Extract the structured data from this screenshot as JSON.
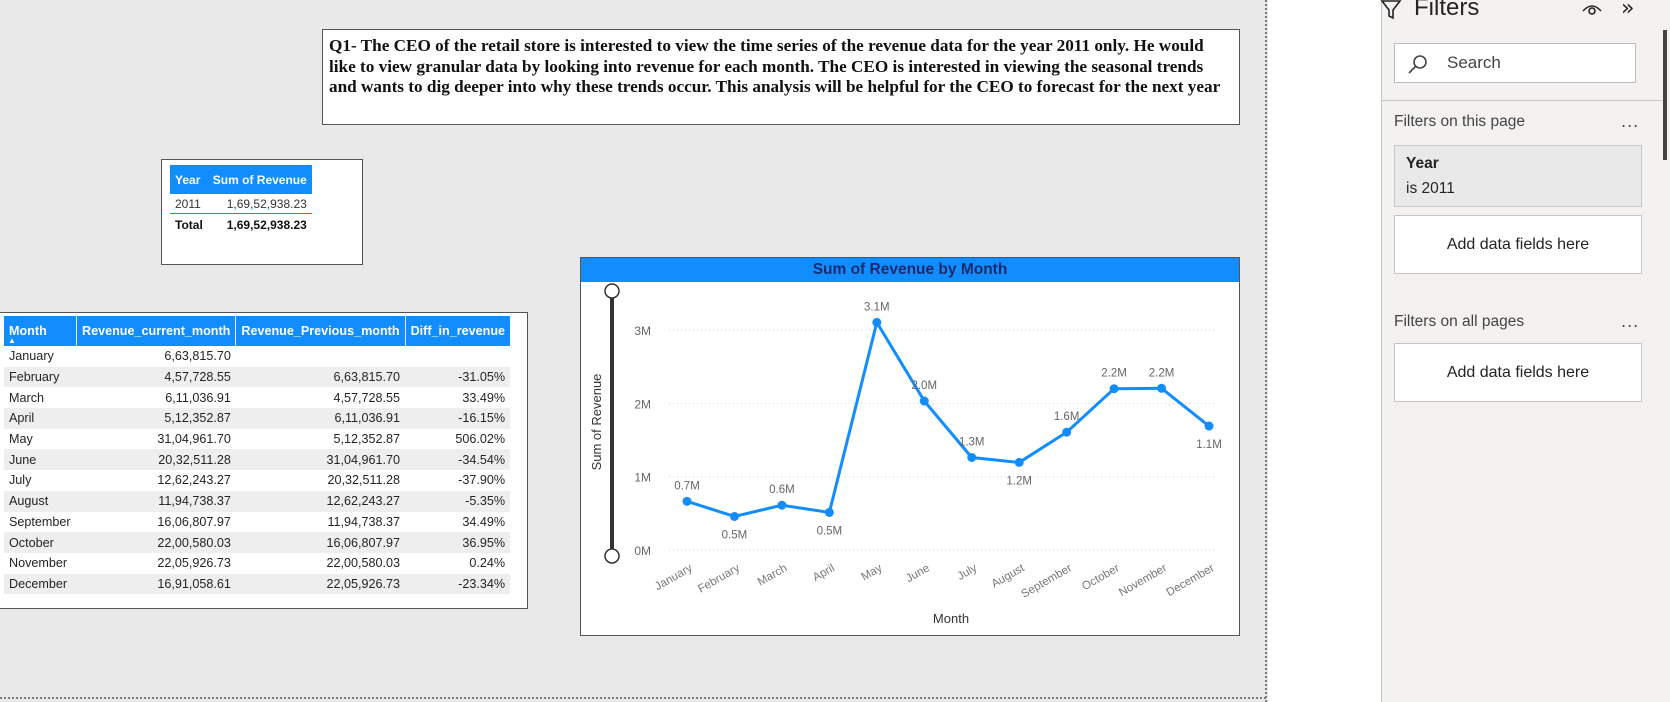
{
  "question": {
    "text": "Q1- The CEO of the retail store is interested to view the time series of the revenue data for the year 2011 only. He would like to view granular data by looking into revenue for each month. The CEO is interested in viewing the seasonal trends and wants to dig deeper into why these trends occur. This analysis will be helpful for the CEO to forecast for the next year"
  },
  "year_table": {
    "headers": [
      "Year",
      "Sum of Revenue"
    ],
    "rows": [
      [
        "2011",
        "1,69,52,938.23"
      ]
    ],
    "total": [
      "Total",
      "1,69,52,938.23"
    ]
  },
  "month_table": {
    "headers": [
      "Month",
      "Revenue_current_month",
      "Revenue_Previous_month",
      "Diff_in_revenue"
    ],
    "sort_indicator": "▲",
    "rows": [
      [
        "January",
        "6,63,815.70",
        "",
        ""
      ],
      [
        "February",
        "4,57,728.55",
        "6,63,815.70",
        "-31.05%"
      ],
      [
        "March",
        "6,11,036.91",
        "4,57,728.55",
        "33.49%"
      ],
      [
        "April",
        "5,12,352.87",
        "6,11,036.91",
        "-16.15%"
      ],
      [
        "May",
        "31,04,961.70",
        "5,12,352.87",
        "506.02%"
      ],
      [
        "June",
        "20,32,511.28",
        "31,04,961.70",
        "-34.54%"
      ],
      [
        "July",
        "12,62,243.27",
        "20,32,511.28",
        "-37.90%"
      ],
      [
        "August",
        "11,94,738.37",
        "12,62,243.27",
        "-5.35%"
      ],
      [
        "September",
        "16,06,807.97",
        "11,94,738.37",
        "34.49%"
      ],
      [
        "October",
        "22,00,580.03",
        "16,06,807.97",
        "36.95%"
      ],
      [
        "November",
        "22,05,926.73",
        "22,00,580.03",
        "0.24%"
      ],
      [
        "December",
        "16,91,058.61",
        "22,05,926.73",
        "-23.34%"
      ]
    ]
  },
  "chart_data": {
    "type": "line",
    "title": "Sum of Revenue by Month",
    "xlabel": "Month",
    "ylabel": "Sum of Revenue",
    "categories": [
      "January",
      "February",
      "March",
      "April",
      "May",
      "June",
      "July",
      "August",
      "September",
      "October",
      "November",
      "December"
    ],
    "series": [
      {
        "values": [
          663815.7,
          457728.55,
          611036.91,
          512352.87,
          3104961.7,
          2032511.28,
          1262243.27,
          1194738.37,
          1606807.97,
          2200580.03,
          2205926.73,
          1691058.61
        ]
      }
    ],
    "data_labels": [
      "0.7M",
      "0.5M",
      "0.6M",
      "0.5M",
      "3.1M",
      "2.0M",
      "1.3M",
      "1.2M",
      "1.6M",
      "2.2M",
      "2.2M",
      "1.1M"
    ],
    "y_ticks": [
      "0M",
      "1M",
      "2M",
      "3M"
    ],
    "ylim": [
      0,
      3500000
    ],
    "grid": true,
    "color": "#118dff"
  },
  "filters_pane": {
    "title": "Filters",
    "search_placeholder": "Search",
    "this_page_label": "Filters on this page",
    "filter_name": "Year",
    "filter_value": "is 2011",
    "add_fields_label": "Add data fields here",
    "all_pages_label": "Filters on all pages",
    "more_label": "..."
  }
}
